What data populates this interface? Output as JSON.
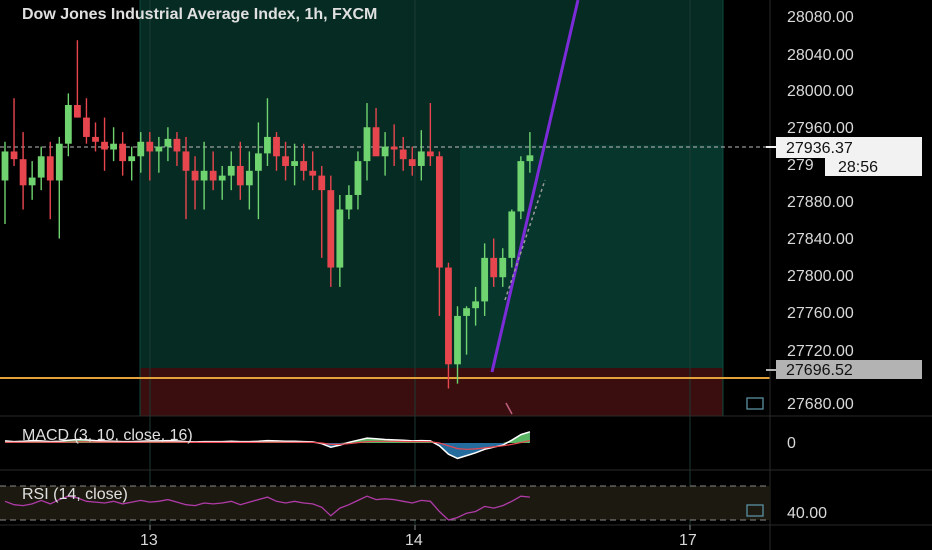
{
  "header": {
    "title": "Dow Jones Industrial Average Index, 1h, FXCM"
  },
  "price_axis": {
    "ticks": [
      "28080.00",
      "28040.00",
      "28000.00",
      "27960.00",
      "27880.00",
      "27840.00",
      "27800.00",
      "27760.00",
      "27720.00",
      "27680.00"
    ],
    "partial_tick": "279",
    "current_price": "27936.37",
    "countdown": "28:56",
    "support_price": "27696.52"
  },
  "time_axis": {
    "labels": [
      "13",
      "14",
      "17"
    ]
  },
  "indicators": {
    "macd": {
      "label": "MACD (3, 10, close, 16)",
      "axis_tick": "0"
    },
    "rsi": {
      "label": "RSI (14, close)",
      "axis_tick": "40.00"
    }
  },
  "colors": {
    "background": "#000000",
    "bull": "#6fd36f",
    "bear": "#e8464f",
    "trendline": "#7b2bd8",
    "support_line": "#e3a23a",
    "teal_zone": "#062a22",
    "red_zone": "#3a0e0e",
    "text": "#d9d9d9"
  },
  "chart_data": {
    "type": "candlestick",
    "title": "Dow Jones Industrial Average Index, 1h, FXCM",
    "ylim": [
      27660,
      28100
    ],
    "x_ticks": [
      "13",
      "14",
      "17"
    ],
    "candles": [
      [
        27910,
        27950,
        27865,
        27940
      ],
      [
        27940,
        27995,
        27925,
        27932
      ],
      [
        27932,
        27960,
        27880,
        27905
      ],
      [
        27905,
        27930,
        27890,
        27913
      ],
      [
        27913,
        27945,
        27900,
        27935
      ],
      [
        27935,
        27950,
        27870,
        27910
      ],
      [
        27910,
        27955,
        27850,
        27948
      ],
      [
        27948,
        28000,
        27935,
        27988
      ],
      [
        27988,
        28055,
        27975,
        27975
      ],
      [
        27975,
        27995,
        27948,
        27955
      ],
      [
        27955,
        27970,
        27940,
        27950
      ],
      [
        27950,
        27975,
        27920,
        27942
      ],
      [
        27942,
        27965,
        27930,
        27948
      ],
      [
        27948,
        27960,
        27915,
        27930
      ],
      [
        27930,
        27945,
        27910,
        27935
      ],
      [
        27935,
        27960,
        27918,
        27950
      ],
      [
        27950,
        27960,
        27910,
        27940
      ],
      [
        27940,
        27955,
        27918,
        27945
      ],
      [
        27945,
        27965,
        27930,
        27953
      ],
      [
        27953,
        27960,
        27925,
        27940
      ],
      [
        27940,
        27955,
        27870,
        27920
      ],
      [
        27920,
        27935,
        27880,
        27910
      ],
      [
        27910,
        27950,
        27880,
        27920
      ],
      [
        27920,
        27940,
        27900,
        27910
      ],
      [
        27910,
        27925,
        27890,
        27915
      ],
      [
        27915,
        27940,
        27900,
        27925
      ],
      [
        27925,
        27950,
        27890,
        27905
      ],
      [
        27905,
        27940,
        27880,
        27920
      ],
      [
        27920,
        27970,
        27870,
        27938
      ],
      [
        27938,
        27995,
        27925,
        27955
      ],
      [
        27955,
        27960,
        27920,
        27935
      ],
      [
        27935,
        27950,
        27910,
        27925
      ],
      [
        27925,
        27948,
        27905,
        27930
      ],
      [
        27930,
        27948,
        27910,
        27920
      ],
      [
        27920,
        27940,
        27900,
        27915
      ],
      [
        27915,
        27925,
        27830,
        27900
      ],
      [
        27900,
        27915,
        27800,
        27820
      ],
      [
        27820,
        27895,
        27800,
        27880
      ],
      [
        27880,
        27905,
        27870,
        27895
      ],
      [
        27895,
        27940,
        27880,
        27930
      ],
      [
        27930,
        27990,
        27910,
        27965
      ],
      [
        27965,
        27985,
        27940,
        27935
      ],
      [
        27935,
        27960,
        27915,
        27945
      ],
      [
        27945,
        27968,
        27925,
        27942
      ],
      [
        27942,
        27955,
        27920,
        27932
      ],
      [
        27932,
        27945,
        27915,
        27925
      ],
      [
        27925,
        27962,
        27910,
        27940
      ],
      [
        27940,
        27990,
        27925,
        27935
      ],
      [
        27935,
        27940,
        27770,
        27820
      ],
      [
        27820,
        27825,
        27695,
        27720
      ],
      [
        27720,
        27780,
        27700,
        27770
      ],
      [
        27770,
        27780,
        27730,
        27778
      ],
      [
        27778,
        27800,
        27760,
        27785
      ],
      [
        27785,
        27845,
        27770,
        27830
      ],
      [
        27830,
        27850,
        27800,
        27810
      ],
      [
        27810,
        27840,
        27800,
        27830
      ],
      [
        27830,
        27880,
        27820,
        27878
      ],
      [
        27878,
        27935,
        27870,
        27930
      ],
      [
        27930,
        27960,
        27918,
        27936
      ]
    ],
    "lines": [
      {
        "name": "trendline",
        "from": [
          49.5,
          27700
        ],
        "to": [
          63,
          28120
        ]
      },
      {
        "name": "support",
        "value": 27696.52
      }
    ],
    "macd": {
      "label": "MACD (3, 10, close, 16)",
      "histogram": [
        0.3,
        0.2,
        0.25,
        0.35,
        0.3,
        0.2,
        0.25,
        0.4,
        0.5,
        0.45,
        0.35,
        0.3,
        0.25,
        0.2,
        0.2,
        0.25,
        0.3,
        0.3,
        0.35,
        0.3,
        0.2,
        0.15,
        0.2,
        0.2,
        0.2,
        0.25,
        0.2,
        0.2,
        0.25,
        0.35,
        0.3,
        0.25,
        0.25,
        0.2,
        0.15,
        -0.1,
        -0.6,
        -0.3,
        0.1,
        0.4,
        0.7,
        0.6,
        0.5,
        0.45,
        0.4,
        0.3,
        0.35,
        0.3,
        -0.4,
        -1.6,
        -2.2,
        -1.8,
        -1.4,
        -0.9,
        -0.6,
        -0.3,
        0.4,
        1.2,
        1.6
      ],
      "signal": [
        0.1,
        0.1,
        0.1,
        0.12,
        0.12,
        0.1,
        0.1,
        0.12,
        0.15,
        0.15,
        0.14,
        0.13,
        0.12,
        0.1,
        0.1,
        0.1,
        0.12,
        0.12,
        0.13,
        0.12,
        0.1,
        0.08,
        0.08,
        0.08,
        0.08,
        0.1,
        0.08,
        0.08,
        0.1,
        0.12,
        0.12,
        0.1,
        0.1,
        0.1,
        0.08,
        0.0,
        -0.2,
        -0.2,
        -0.1,
        0.05,
        0.2,
        0.25,
        0.25,
        0.25,
        0.22,
        0.2,
        0.2,
        0.18,
        0.0,
        -0.4,
        -0.8,
        -0.9,
        -0.85,
        -0.7,
        -0.55,
        -0.4,
        -0.2,
        0.05,
        0.35
      ]
    },
    "rsi": {
      "label": "RSI (14, close)",
      "ylim": [
        20,
        80
      ],
      "bands": [
        30,
        70
      ],
      "values": [
        52,
        48,
        47,
        49,
        53,
        49,
        54,
        58,
        56,
        52,
        51,
        50,
        52,
        49,
        51,
        53,
        51,
        52,
        54,
        51,
        48,
        47,
        50,
        49,
        50,
        52,
        48,
        51,
        54,
        57,
        52,
        50,
        52,
        50,
        49,
        45,
        35,
        44,
        48,
        53,
        58,
        54,
        55,
        54,
        52,
        50,
        53,
        52,
        40,
        30,
        33,
        38,
        40,
        46,
        44,
        47,
        52,
        58,
        57
      ]
    }
  }
}
